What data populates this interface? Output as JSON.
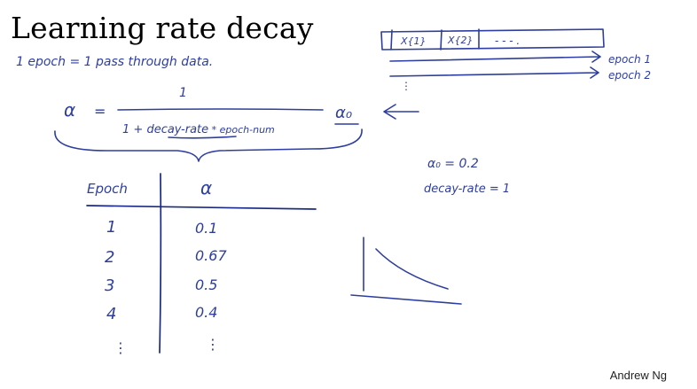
{
  "slide": {
    "title": "Learning rate decay",
    "author": "Andrew Ng"
  },
  "notes": {
    "epoch_definition": "1 epoch = 1 pass through data.",
    "formula": {
      "lhs": "α",
      "equals": "=",
      "numerator": "1",
      "denominator_prefix": "1 + ",
      "denominator_term1": "decay-rate",
      "denominator_term2": " * epoch-num",
      "multiplier": "α₀"
    },
    "minibatch_strip": {
      "cells": [
        "X{1}",
        "X{2}",
        "- - - ."
      ],
      "epoch_labels": [
        "epoch 1",
        "epoch 2"
      ],
      "more": "⋮"
    },
    "params": {
      "alpha0": "α₀ = 0.2",
      "decay_rate": "decay-rate = 1"
    },
    "table": {
      "headers": [
        "Epoch",
        "α"
      ],
      "rows": [
        {
          "epoch": "1",
          "alpha": "0.1"
        },
        {
          "epoch": "2",
          "alpha": "0.67"
        },
        {
          "epoch": "3",
          "alpha": "0.5"
        },
        {
          "epoch": "4",
          "alpha": "0.4"
        }
      ],
      "ellipsis_epoch": "⋮",
      "ellipsis_alpha": "⋮"
    },
    "colors": {
      "ink": "#2d3e9e",
      "title": "#000000"
    }
  }
}
